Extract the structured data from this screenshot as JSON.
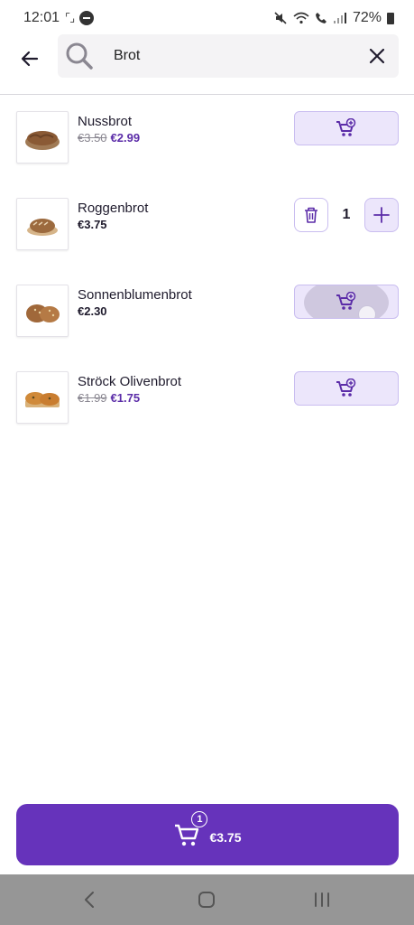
{
  "status_bar": {
    "time": "12:01",
    "battery": "72%"
  },
  "search": {
    "value": "Brot"
  },
  "products": [
    {
      "name": "Nussbrot",
      "old_price": "€3.50",
      "price": "€2.99"
    },
    {
      "name": "Roggenbrot",
      "price": "€3.75",
      "quantity": "1"
    },
    {
      "name": "Sonnenblumenbrot",
      "price": "€2.30"
    },
    {
      "name": "Ströck Olivenbrot",
      "old_price": "€1.99",
      "price": "€1.75"
    }
  ],
  "cart": {
    "count": "1",
    "total": "€3.75"
  },
  "colors": {
    "accent": "#6633bb",
    "accent_light": "#ece6fb",
    "price": "#5b2ca8",
    "nav_bar": "#969696"
  },
  "icons": {
    "back": "arrow-left-icon",
    "search": "search-icon",
    "clear": "close-icon",
    "add_to_cart": "cart-plus-icon",
    "delete": "trash-icon",
    "increment": "plus-icon",
    "cart": "cart-icon",
    "nav_back": "chevron-left-icon",
    "nav_home": "home-icon",
    "nav_recents": "recents-icon"
  }
}
